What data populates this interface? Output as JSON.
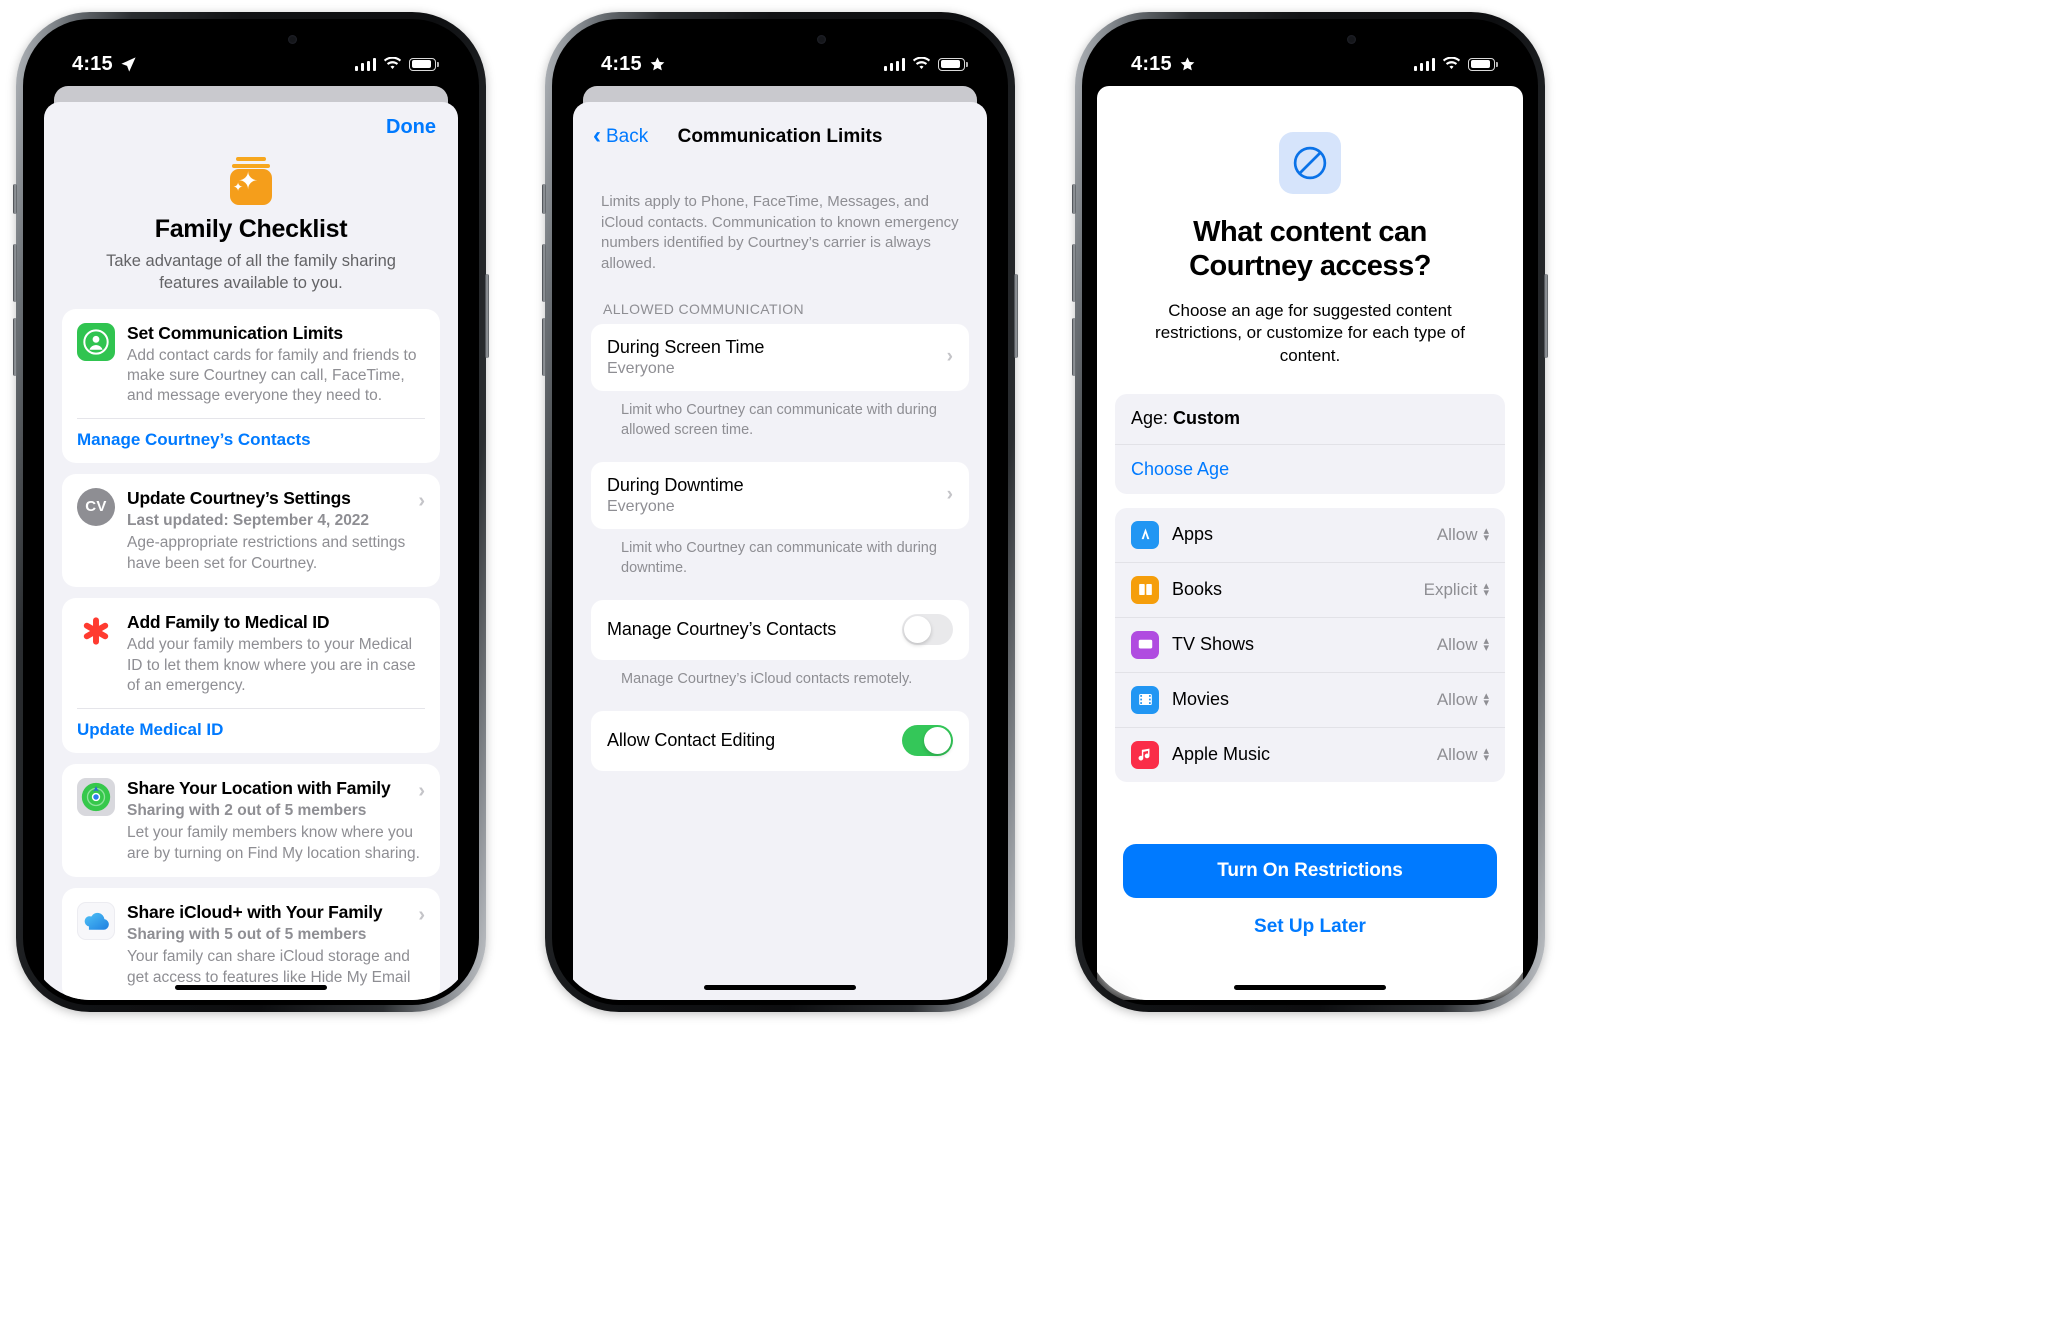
{
  "phones": [
    {
      "status": {
        "time": "4:15",
        "location_icon": "location-arrow-icon"
      },
      "done_label": "Done",
      "hero": {
        "title": "Family Checklist",
        "subtitle": "Take advantage of all the family sharing features available to you."
      },
      "cards": [
        {
          "icon": "contacts-icon",
          "icon_color": "#30c450",
          "title": "Set Communication Limits",
          "subtitle": "Add contact cards for family and friends to make sure Courtney can call, FaceTime, and message everyone they need to.",
          "link": "Manage Courtney’s Contacts"
        },
        {
          "icon": "avatar-initials",
          "initials": "CV",
          "title": "Update Courtney’s Settings",
          "meta": "Last updated: September 4, 2022",
          "subtitle": "Age-appropriate restrictions and settings have been set for Courtney.",
          "chevron": true
        },
        {
          "icon": "medical-id-icon",
          "icon_color": "#ff3b30",
          "title": "Add Family to Medical ID",
          "subtitle": "Add your family members to your Medical ID to let them know where you are in case of an emergency.",
          "link": "Update Medical ID"
        },
        {
          "icon": "find-my-icon",
          "title": "Share Your Location with Family",
          "meta": "Sharing with 2 out of 5 members",
          "subtitle": "Let your family members know where you are by turning on Find My location sharing.",
          "chevron": true
        },
        {
          "icon": "icloud-icon",
          "title": "Share iCloud+ with Your Family",
          "meta": "Sharing with 5 out of 5 members",
          "subtitle": "Your family can share iCloud storage and get access to features like Hide My Email",
          "chevron": true
        }
      ]
    },
    {
      "status": {
        "time": "4:15",
        "location_icon": "star-icon"
      },
      "nav": {
        "back": "Back",
        "title": "Communication Limits"
      },
      "blurb": "Limits apply to Phone, FaceTime, Messages, and iCloud contacts. Communication to known emergency numbers identified by Courtney’s carrier is always allowed.",
      "section_header": "ALLOWED COMMUNICATION",
      "rows": [
        {
          "title": "During Screen Time",
          "value": "Everyone",
          "type": "chevron",
          "footer": "Limit who Courtney can communicate with during allowed screen time."
        },
        {
          "title": "During Downtime",
          "value": "Everyone",
          "type": "chevron",
          "footer": "Limit who Courtney can communicate with during downtime."
        },
        {
          "title": "Manage Courtney’s Contacts",
          "type": "toggle",
          "on": false,
          "footer": "Manage Courtney’s iCloud contacts remotely."
        },
        {
          "title": "Allow Contact Editing",
          "type": "toggle",
          "on": true,
          "footer": ""
        }
      ]
    },
    {
      "status": {
        "time": "4:15",
        "location_icon": "star-icon"
      },
      "hero": {
        "icon": "no-entry-icon",
        "title": "What content can Courtney access?",
        "subtitle": "Choose an age for suggested content restrictions, or customize for each type of content."
      },
      "age_group": {
        "label_prefix": "Age: ",
        "label_value": "Custom",
        "choose": "Choose Age"
      },
      "content_rows": [
        {
          "icon": "app-store-icon",
          "icon_color": "#2196f3",
          "name": "Apps",
          "value": "Allow"
        },
        {
          "icon": "books-icon",
          "icon_color": "#f59e0b",
          "name": "Books",
          "value": "Explicit"
        },
        {
          "icon": "tv-icon",
          "icon_color": "#b04ce0",
          "name": "TV Shows",
          "value": "Allow"
        },
        {
          "icon": "movies-icon",
          "icon_color": "#2196f3",
          "name": "Movies",
          "value": "Allow"
        },
        {
          "icon": "music-icon",
          "icon_color": "#fa2d48",
          "name": "Apple Music",
          "value": "Allow"
        }
      ],
      "cta": "Turn On Restrictions",
      "later": "Set Up Later"
    }
  ]
}
